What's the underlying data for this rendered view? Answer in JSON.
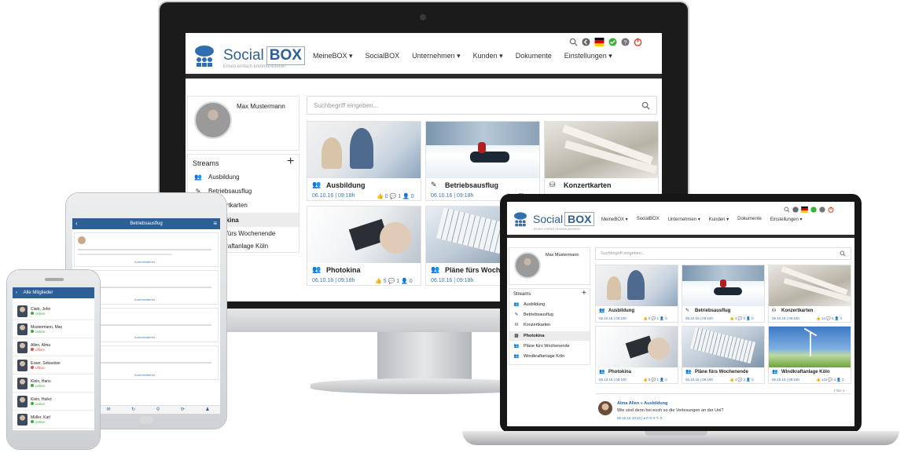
{
  "brand": {
    "social": "Social",
    "box": "BOX",
    "tagline": "Ernen einfach kommunizieren"
  },
  "nav": {
    "items": [
      "MeineBOX ▾",
      "SocialBOX",
      "Unternehmen ▾",
      "Kunden ▾",
      "Dokumente",
      "Einstellungen ▾"
    ]
  },
  "user": {
    "name": "Max Mustermann"
  },
  "search": {
    "placeholder": "Suchbegriff eingeben..."
  },
  "streams": {
    "heading": "Streams",
    "add": "+",
    "items": [
      "Ausbildung",
      "Betriebsausflug",
      "Konzertkarten",
      "Photokina",
      "Pläne fürs Wochenende",
      "Windkraftanlage Köln"
    ]
  },
  "cards": [
    {
      "title": "Ausbildung",
      "meta": "06.10.16 | 09:18h",
      "likes": "0",
      "comments": "1",
      "members": "0"
    },
    {
      "title": "Betriebsausflug",
      "meta": "06.10.16 | 09:18h",
      "likes": "4",
      "comments": "0",
      "members": "0"
    },
    {
      "title": "Konzertkarten",
      "meta": "06.10.16 | 09:18h",
      "likes": "14",
      "comments": "4",
      "members": "0"
    },
    {
      "title": "Photokina",
      "meta": "06.10.16 | 09:18h",
      "likes": "5",
      "comments": "1",
      "members": "0"
    },
    {
      "title": "Pläne fürs Wochenende",
      "meta": "06.10.16 | 09:18h",
      "likes": "4",
      "comments": "2",
      "members": "0"
    },
    {
      "title": "Windkraftanlage Köln",
      "meta": "06.10.16 | 09:18h",
      "likes": "141",
      "comments": "4",
      "members": "0"
    }
  ],
  "feed": {
    "filter": "Filter ▾",
    "author": "Alma Allen » Ausbildung",
    "text": "Wie sind denn bei euch so die Vorlesungen an der Uni?",
    "meta": "06.10.16 10:20 | ♦ 0  ✉ 0  ✎ 0"
  },
  "tablet": {
    "title": "Betriebsausflug",
    "post_labels": [
      "Kommentieren",
      "Kommentieren",
      "Kommentieren",
      "Kommentieren"
    ]
  },
  "phone": {
    "title": "Alle Mitglieder",
    "members": [
      {
        "name": "Clark, John",
        "status": "online",
        "color": "#3cae3c"
      },
      {
        "name": "Mustermann, Max",
        "status": "online",
        "color": "#3cae3c"
      },
      {
        "name": "Allen, Alma",
        "status": "offline",
        "color": "#d9534f"
      },
      {
        "name": "Esser, Sebastian",
        "status": "offline",
        "color": "#d9534f"
      },
      {
        "name": "Klein, Hans",
        "status": "online",
        "color": "#3cae3c"
      },
      {
        "name": "Klein, Heiko",
        "status": "online",
        "color": "#3cae3c"
      },
      {
        "name": "Müller, Karl",
        "status": "online",
        "color": "#3cae3c"
      }
    ]
  },
  "colors": {
    "brand_blue": "#2f5f94",
    "link_blue": "#3c78b4",
    "header_bar": "#2b2b2b",
    "online": "#3cae3c",
    "offline": "#d9534f"
  }
}
